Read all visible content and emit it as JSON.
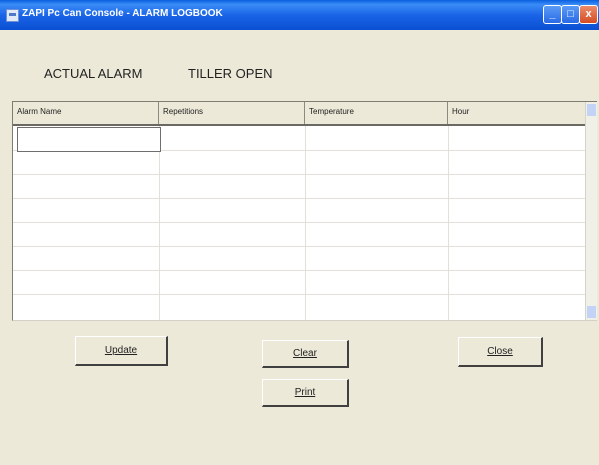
{
  "window": {
    "title": "ZAPI Pc Can Console - ALARM LOGBOOK",
    "controls": {
      "minimize": "_",
      "maximize": "□",
      "close": "x"
    }
  },
  "alarm": {
    "label": "ACTUAL ALARM",
    "value": "TILLER OPEN"
  },
  "grid": {
    "columns": [
      "Alarm Name",
      "Repetitions",
      "Temperature",
      "Hour"
    ],
    "rows": [
      [
        "",
        "",
        "",
        ""
      ],
      [
        "",
        "",
        "",
        ""
      ],
      [
        "",
        "",
        "",
        ""
      ],
      [
        "",
        "",
        "",
        ""
      ],
      [
        "",
        "",
        "",
        ""
      ],
      [
        "",
        "",
        "",
        ""
      ],
      [
        "",
        "",
        "",
        ""
      ],
      [
        "",
        "",
        "",
        ""
      ]
    ]
  },
  "buttons": {
    "update": "Update",
    "clear": "Clear",
    "close": "Close",
    "print": "Print"
  }
}
